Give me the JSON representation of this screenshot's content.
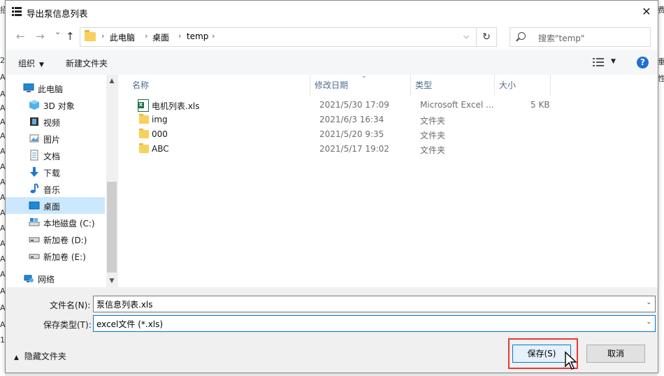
{
  "background": {
    "left_fragments": [
      "招",
      "2",
      "A",
      "A",
      "A",
      "A",
      "A",
      "A",
      "A",
      "A",
      "A",
      "A",
      "A",
      "A",
      "A",
      "A",
      "A",
      "A",
      "A",
      "1"
    ],
    "right_fragments": [
      "费",
      "重",
      "性",
      "",
      "",
      "",
      "",
      "",
      "",
      "",
      "",
      "",
      "",
      "",
      "",
      "",
      "",
      "",
      "",
      ""
    ]
  },
  "dialog": {
    "title": "导出泵信息列表",
    "close_label": "✕"
  },
  "nav": {
    "back": "←",
    "forward": "→",
    "recent": "⌄",
    "up": "↑",
    "breadcrumbs": [
      "此电脑",
      "桌面",
      "temp"
    ],
    "separator": "›",
    "refresh": "↻",
    "search_placeholder": "搜索\"temp\""
  },
  "toolbar": {
    "organize": "组织",
    "new_folder": "新建文件夹",
    "help": "?"
  },
  "sidebar": {
    "items": [
      {
        "label": "此电脑",
        "icon": "computer-icon"
      },
      {
        "label": "3D 对象",
        "icon": "3d-objects-icon"
      },
      {
        "label": "视频",
        "icon": "video-icon"
      },
      {
        "label": "图片",
        "icon": "pictures-icon"
      },
      {
        "label": "文档",
        "icon": "documents-icon"
      },
      {
        "label": "下载",
        "icon": "download-icon"
      },
      {
        "label": "音乐",
        "icon": "music-icon"
      },
      {
        "label": "桌面",
        "icon": "desktop-icon",
        "selected": true
      },
      {
        "label": "本地磁盘 (C:)",
        "icon": "local-disk-icon"
      },
      {
        "label": "新加卷 (D:)",
        "icon": "drive-icon"
      },
      {
        "label": "新加卷 (E:)",
        "icon": "drive-icon"
      },
      {
        "label": "网络",
        "icon": "network-icon"
      }
    ]
  },
  "files": {
    "columns": [
      "名称",
      "修改日期",
      "类型",
      "大小"
    ],
    "rows": [
      {
        "name": "电机列表.xls",
        "date": "2021/5/30 17:09",
        "type": "Microsoft Excel ...",
        "size": "5 KB",
        "icon": "excel-file-icon"
      },
      {
        "name": "img",
        "date": "2021/6/3 16:34",
        "type": "文件夹",
        "size": "",
        "icon": "folder-icon"
      },
      {
        "name": "000",
        "date": "2021/5/20 9:35",
        "type": "文件夹",
        "size": "",
        "icon": "folder-icon"
      },
      {
        "name": "ABC",
        "date": "2021/5/17 19:02",
        "type": "文件夹",
        "size": "",
        "icon": "folder-icon"
      }
    ]
  },
  "form": {
    "filename_label": "文件名(N):",
    "filename_value": "泵信息列表.xls",
    "filetype_label": "保存类型(T):",
    "filetype_value": "excel文件 (*.xls)",
    "hide_folders": "隐藏文件夹",
    "save": "保存(S)",
    "cancel": "取消"
  },
  "colors": {
    "accent": "#0078d7",
    "selection": "#cce8ff",
    "highlight_box": "#e53935",
    "folder": "#f7d15c"
  }
}
